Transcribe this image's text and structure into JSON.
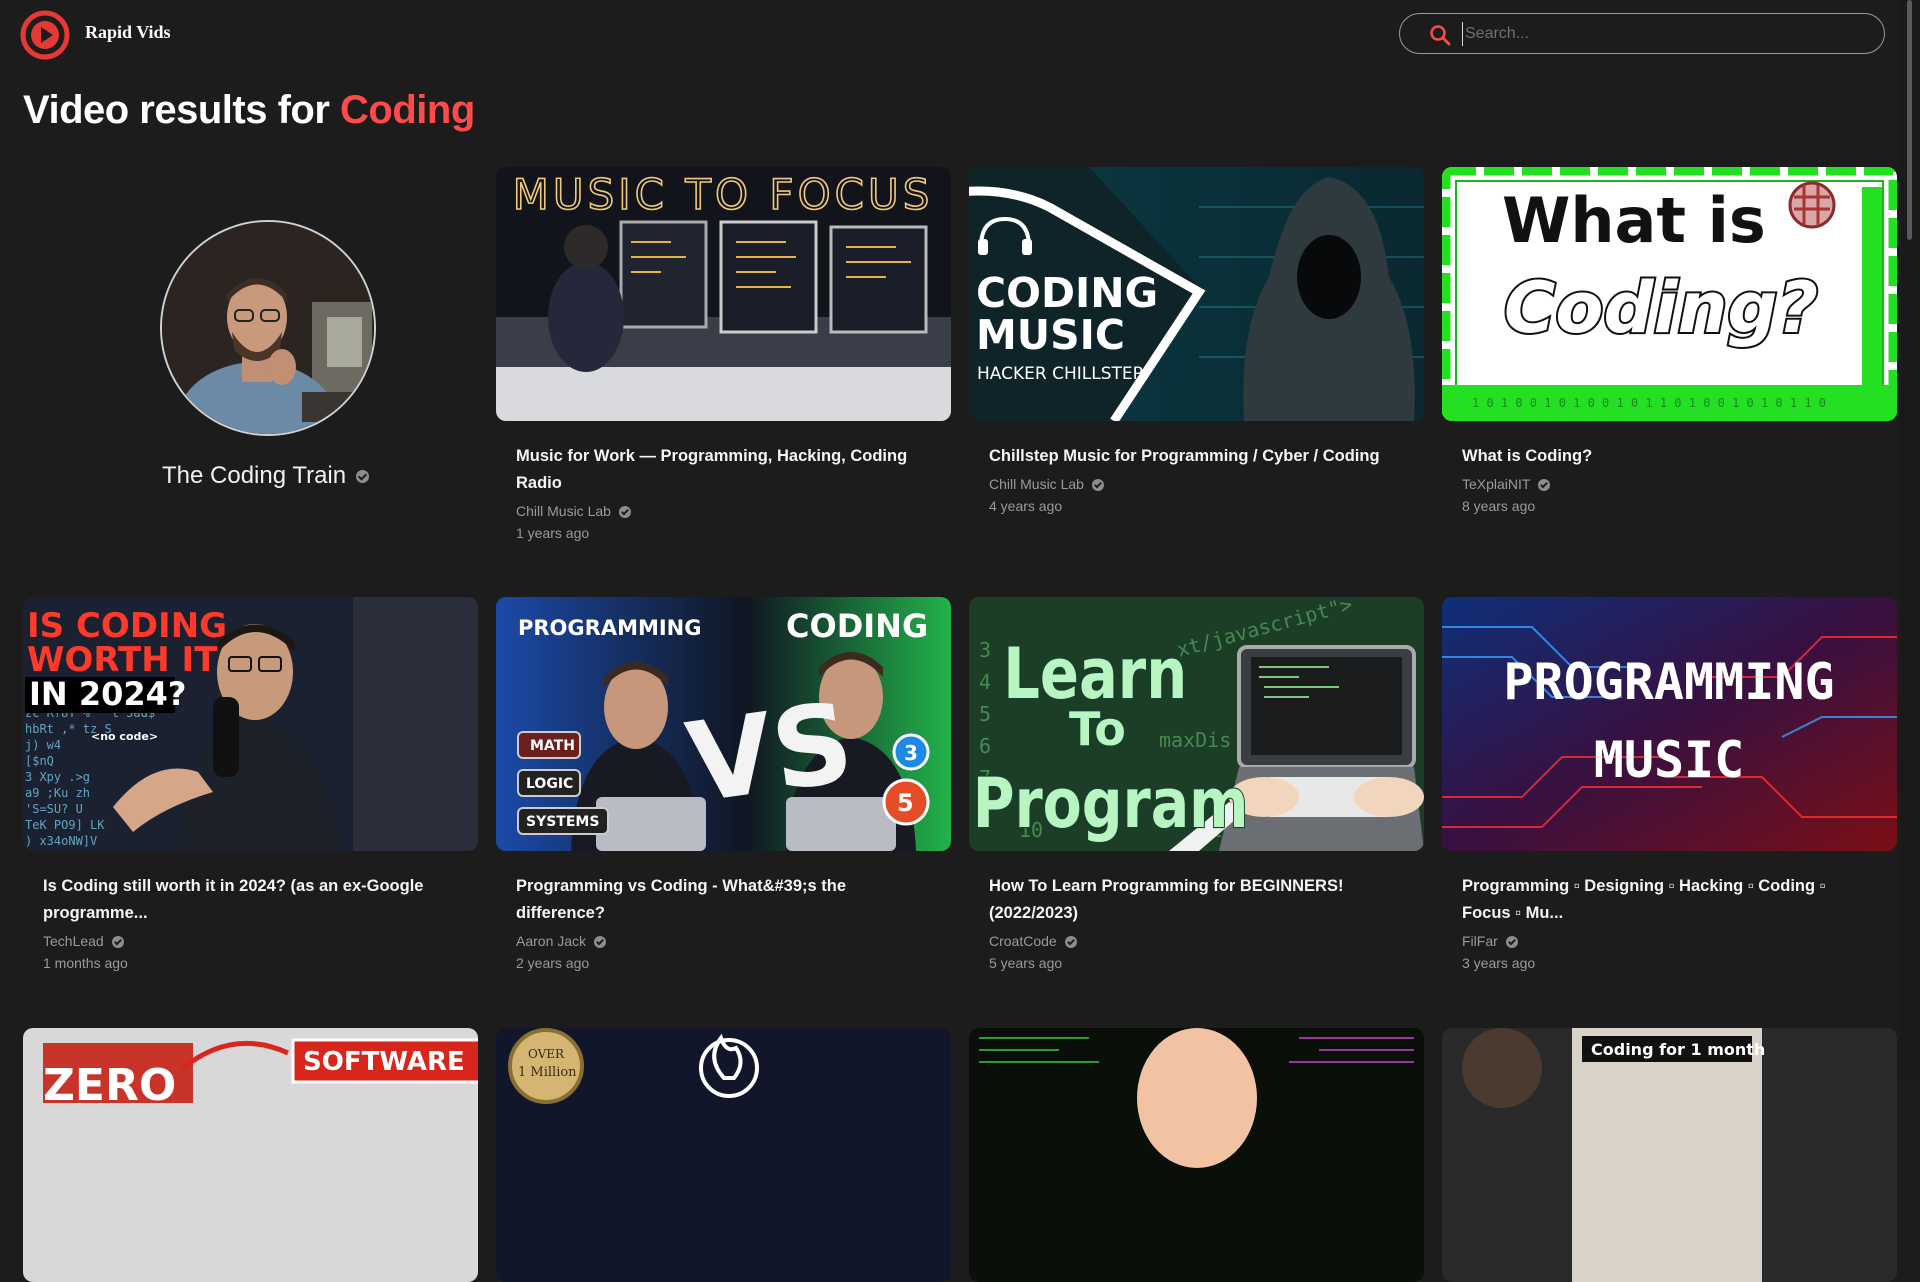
{
  "app": {
    "name": "Rapid Vids"
  },
  "search": {
    "placeholder": "Search..."
  },
  "heading": {
    "prefix": "Video results for",
    "query": "Coding"
  },
  "channel": {
    "name": "The Coding Train"
  },
  "colors": {
    "accent": "#ff4a4a",
    "background": "#1c1c1c",
    "meta": "#9a9a9a"
  },
  "videos": [
    {
      "title": "Music for Work — Programming, Hacking, Coding Radio",
      "channel": "Chill Music Lab",
      "time": "1 years ago",
      "thumb_text": "MUSIC TO FOCUS"
    },
    {
      "title": "Chillstep Music for Programming / Cyber / Coding",
      "channel": "Chill Music Lab",
      "time": "4 years ago",
      "thumb_text": [
        "CODING",
        "MUSIC",
        "HACKER CHILLSTEP"
      ]
    },
    {
      "title": "What is Coding?",
      "channel": "TeXplaiNIT",
      "time": "8 years ago",
      "thumb_text": [
        "What is",
        "Coding?"
      ]
    },
    {
      "title": "Is Coding still worth it in 2024? (as an ex-Google programme...",
      "channel": "TechLead",
      "time": "1 months ago",
      "thumb_text": [
        "IS CODING",
        "WORTH IT",
        "IN 2024?",
        "<no code>"
      ]
    },
    {
      "title": "Programming vs Coding - What&#39;s the difference?",
      "channel": "Aaron Jack",
      "time": "2 years ago",
      "thumb_text": [
        "PROGRAMMING",
        "CODING",
        "VS",
        "MATH",
        "LOGIC",
        "SYSTEMS"
      ]
    },
    {
      "title": "How To Learn Programming for BEGINNERS! (2022/2023)",
      "channel": "CroatCode",
      "time": "5 years ago",
      "thumb_text": [
        "Learn",
        "To",
        "Program"
      ]
    },
    {
      "title": "Programming ▫ Designing ▫ Hacking ▫ Coding ▫ Focus ▫ Mu...",
      "channel": "FilFar",
      "time": "3 years ago",
      "thumb_text": [
        "PROGRAMMING",
        "MUSIC"
      ]
    },
    {
      "title": "",
      "channel": "",
      "time": "",
      "thumb_text": [
        "SOFTWARE",
        "ZERO"
      ]
    },
    {
      "title": "",
      "channel": "",
      "time": "",
      "thumb_text": [
        "OVER",
        "1 Million"
      ]
    },
    {
      "title": "",
      "channel": "",
      "time": "",
      "thumb_text": []
    },
    {
      "title": "",
      "channel": "",
      "time": "",
      "thumb_text": [
        "Coding for 1 month"
      ]
    }
  ]
}
